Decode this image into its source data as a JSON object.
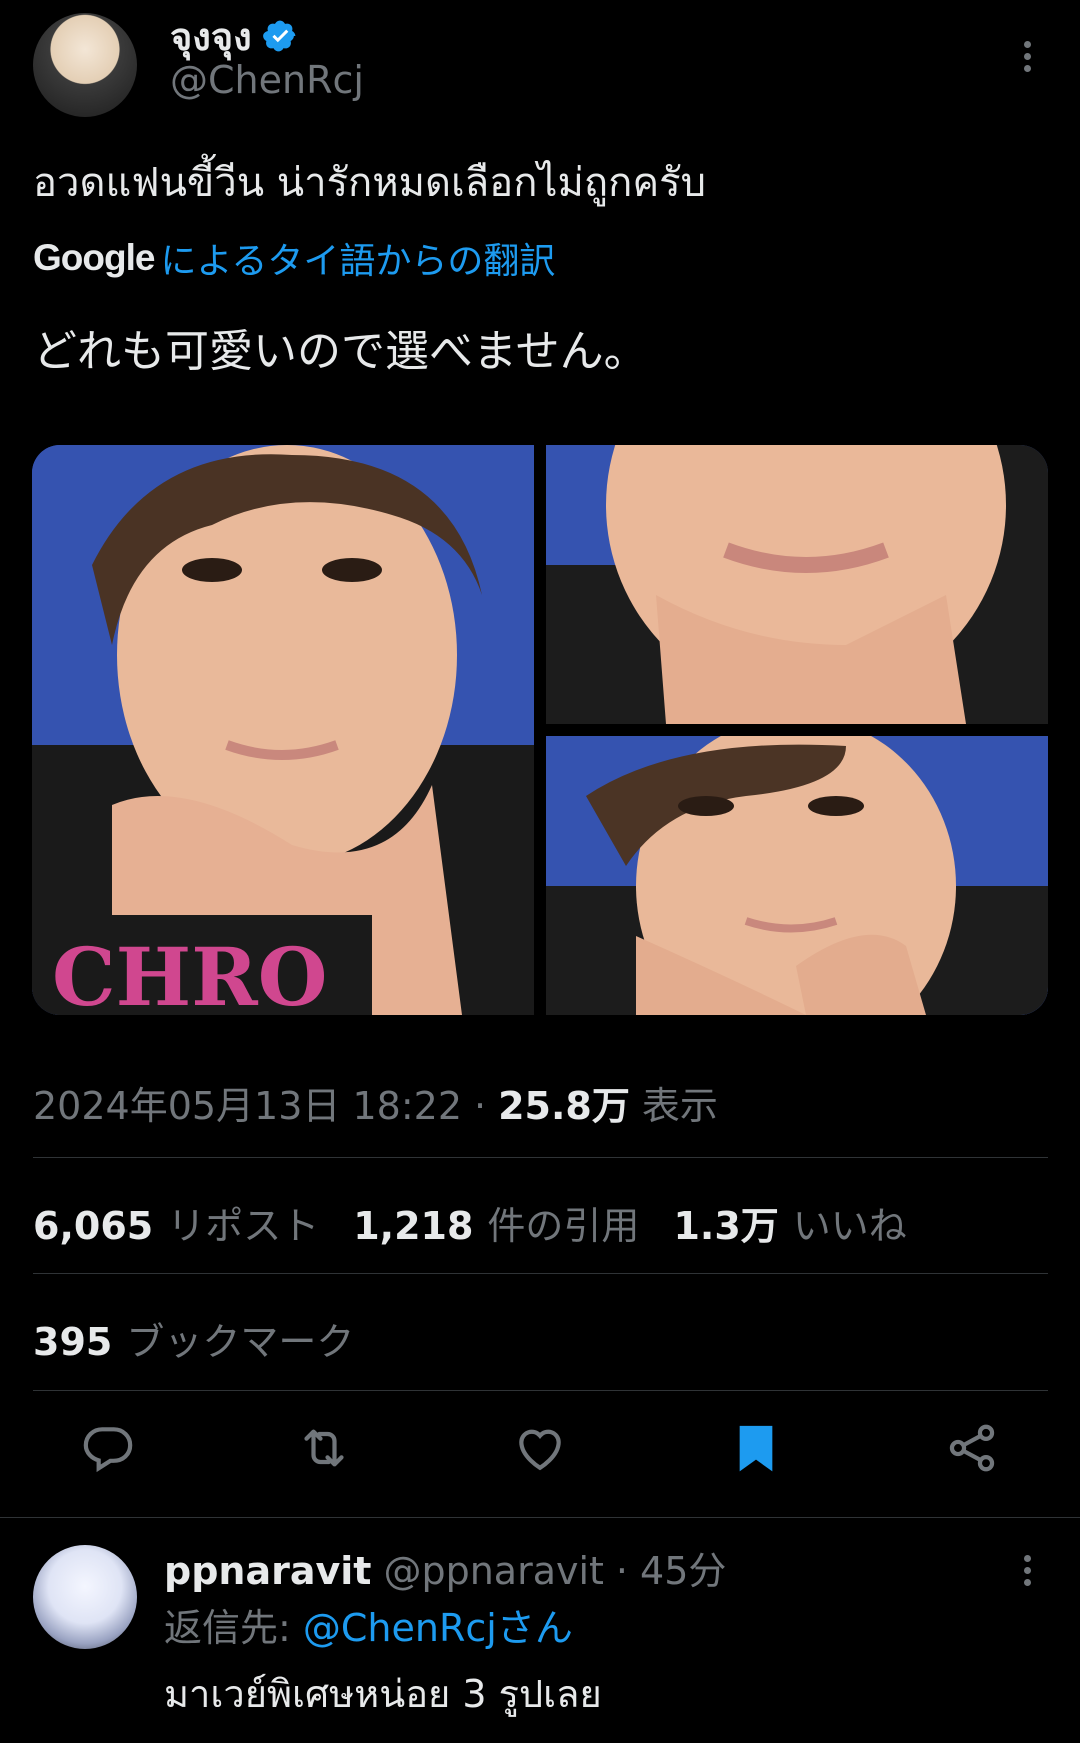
{
  "author": {
    "display_name": "จุงจุง",
    "handle": "@ChenRcj",
    "verified": true
  },
  "tweet": {
    "text": "อวดแฟนขี้วีน น่ารักหมดเลือกไม่ถูกครับ",
    "translate_brand": "Google",
    "translate_label": "によるタイ語からの翻訳",
    "translated_text": "どれも可愛いので選べません。",
    "timestamp": "2024年05月13日 18:22",
    "separator": "·",
    "views_count": "25.8万",
    "views_label": "表示"
  },
  "stats": {
    "reposts_count": "6,065",
    "reposts_label": "リポスト",
    "quotes_count": "1,218",
    "quotes_label": "件の引用",
    "likes_count": "1.3万",
    "likes_label": "いいね",
    "bookmarks_count": "395",
    "bookmarks_label": "ブックマーク"
  },
  "actions": [
    {
      "icon": "reply-icon"
    },
    {
      "icon": "retweet-icon"
    },
    {
      "icon": "like-icon"
    },
    {
      "icon": "bookmark-icon",
      "active": true,
      "color": "#1d9bf0"
    },
    {
      "icon": "share-icon"
    }
  ],
  "reply": {
    "display_name": "ppnaravit",
    "handle": "@ppnaravit",
    "separator": "·",
    "time": "45分",
    "reply_to_prefix": "返信先: ",
    "reply_to_mention": "@ChenRcjさん",
    "text": "มาเวย์พิเศษหน่อย 3 รูปเลย"
  },
  "colors": {
    "background": "#000000",
    "text_primary": "#e7e9ea",
    "text_secondary": "#71767b",
    "accent": "#1d9bf0",
    "divider": "#2f3336"
  }
}
